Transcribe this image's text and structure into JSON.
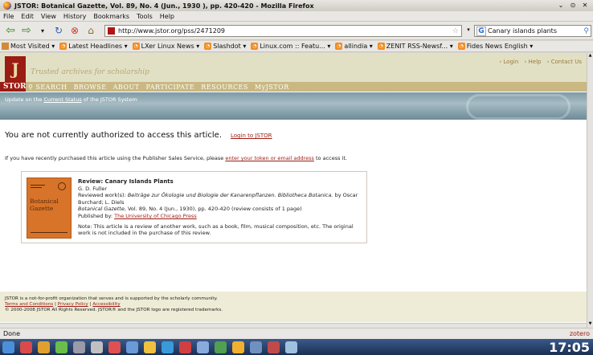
{
  "window": {
    "title": "JSTOR: Botanical Gazette, Vol. 89, No. 4 (Jun., 1930 ), pp. 420-420 - Mozilla Firefox",
    "controls": [
      "⌄",
      "⊙",
      "✕"
    ]
  },
  "menubar": [
    "File",
    "Edit",
    "View",
    "History",
    "Bookmarks",
    "Tools",
    "Help"
  ],
  "navbar": {
    "url": "http://www.jstor.org/pss/2471209",
    "search_value": "Canary islands plants"
  },
  "bookmarks": [
    "Most Visited ▾",
    "Latest Headlines ▾",
    "LXer Linux News ▾",
    "Slashdot ▾",
    "Linux.com :: Featu... ▾",
    "allindia ▾",
    "ZENIT RSS-Newsf... ▾",
    "Fides News English ▾"
  ],
  "jstor": {
    "logo_letter": "J",
    "tagline": "Trusted archives for scholarship",
    "toplinks": [
      "› Login",
      "› Help",
      "› Contact Us"
    ],
    "nav_brand": "STOR",
    "nav": [
      "SEARCH",
      "BROWSE",
      "ABOUT",
      "PARTICIPATE",
      "RESOURCES",
      "MyJSTOR"
    ],
    "status_pre": "Update on the ",
    "status_link": "Current Status",
    "status_post": " of the JSTOR System",
    "not_authorized": "You are not currently authorized to access this article.",
    "login_link": "Login to JSTOR",
    "purchased_pre": "If you have recently purchased this article using the Publisher Sales Service, please ",
    "purchased_link": "enter your token or email address",
    "purchased_post": " to access it.",
    "review": {
      "cover_title": "Botanical Gazette",
      "title": "Review: Canary Islands Plants",
      "author": "G. D. Fuller",
      "reviewed_label": "Reviewed work(s): ",
      "reviewed_work": "Beiträge zur Ökologie und Biologie der Kanarenpflanzen. Bibliotheca Botanica.",
      "reviewed_by": " by Oscar Burchard; L. Diels",
      "journal": "Botanical Gazette",
      "citation": ", Vol. 89, No. 4 (Jun., 1930), pp. 420-420   (review consists of 1 page)",
      "published_label": "Published by: ",
      "publisher": "The University of Chicago Press",
      "note": "Note: This article is a review of another work, such as a book, film, musical composition, etc. The original work is not included in the purchase of this review."
    },
    "footer": {
      "line1": "JSTOR is a not-for-profit organization that serves and is supported by the scholarly community.",
      "terms": "Terms and Conditions",
      "privacy": "Privacy Policy",
      "accessibility": "Accessibility",
      "sep": " | ",
      "copyright": "© 2000-2008 JSTOR All Rights Reserved. JSTOR® and the JSTOR logo are registered trademarks."
    }
  },
  "statusbar": {
    "text": "Done",
    "zotero": "zotero"
  },
  "taskbar": {
    "clock": "17:05",
    "icon_colors": [
      "#4a90d9",
      "#d94a4a",
      "#e0a030",
      "#6abf4b",
      "#9a9aa8",
      "#c0c0c0",
      "#e05050",
      "#6a9ad9",
      "#f0c040",
      "#3a9ad9",
      "#d04040",
      "#88aadd",
      "#50a050",
      "#f0b030",
      "#7090c0",
      "#c04a4a",
      "#a0c0e0"
    ]
  }
}
